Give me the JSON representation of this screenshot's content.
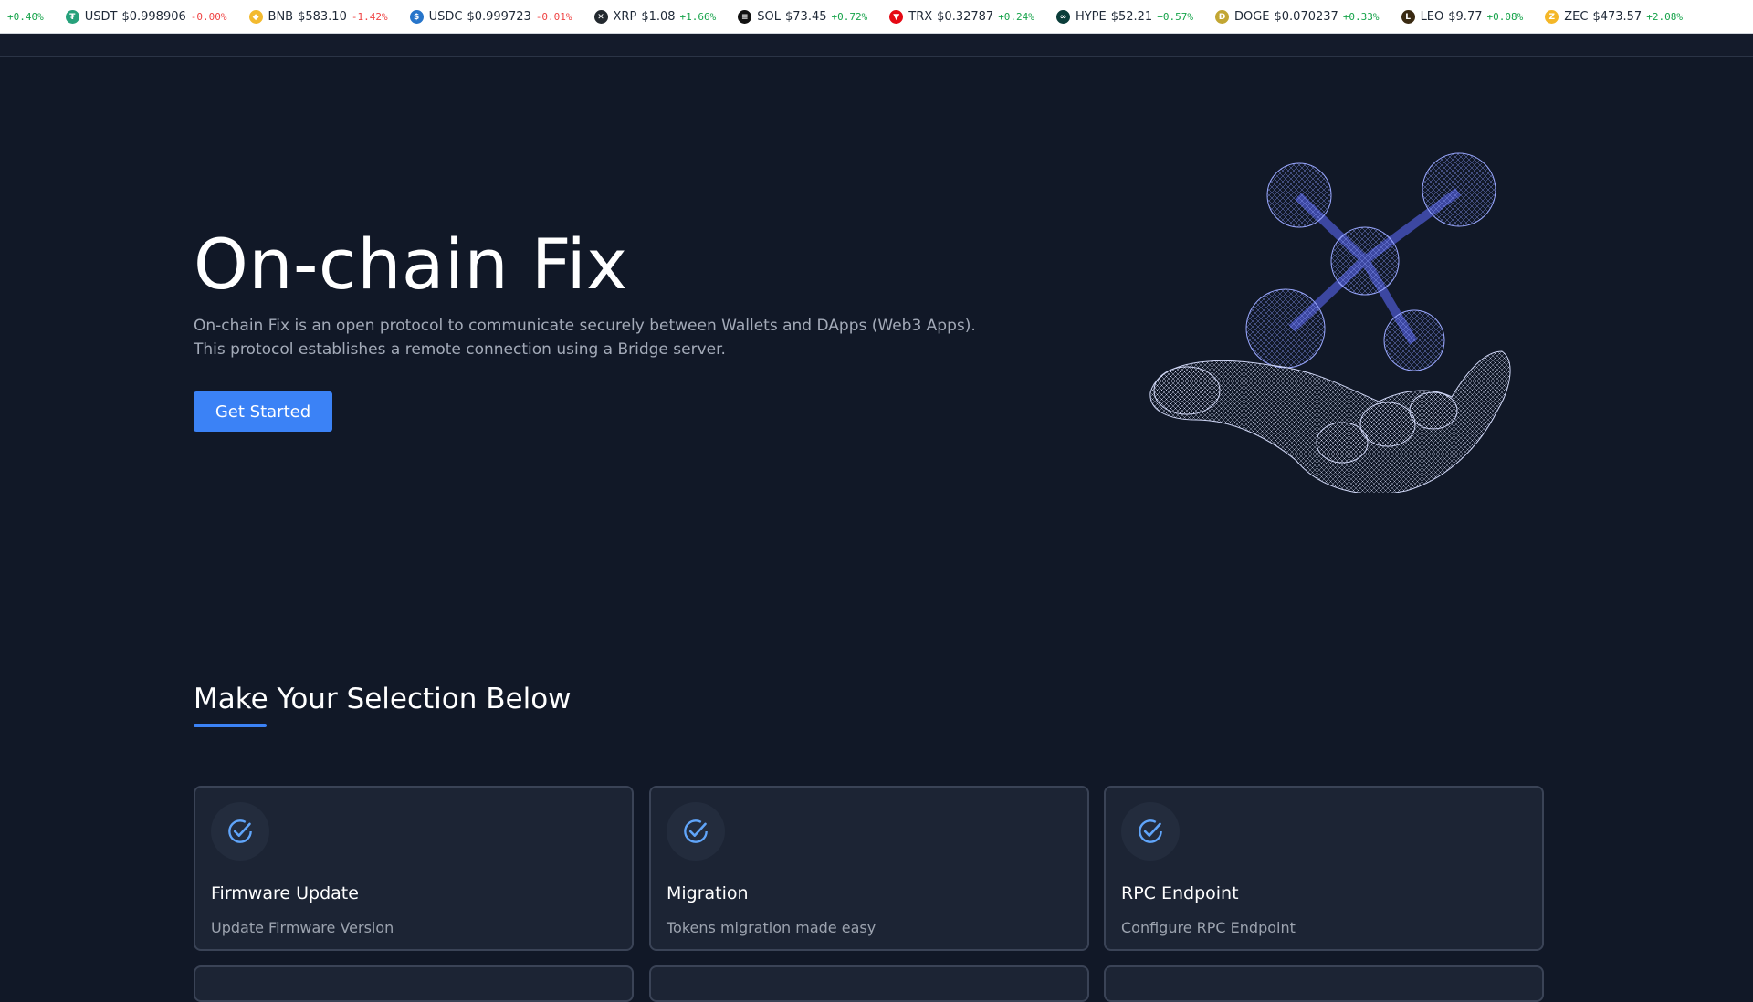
{
  "ticker": [
    {
      "symbol": "",
      "price": "",
      "change": "+0.40%",
      "dir": "up",
      "icon": "partial-coin-icon",
      "color": "#ffffff",
      "glyph": ""
    },
    {
      "symbol": "USDT",
      "price": "$0.998906",
      "change": "-0.00%",
      "dir": "down",
      "icon": "tether-icon",
      "color": "#26a17b",
      "glyph": "₮"
    },
    {
      "symbol": "BNB",
      "price": "$583.10",
      "change": "-1.42%",
      "dir": "down",
      "icon": "bnb-icon",
      "color": "#f3ba2f",
      "glyph": "◆"
    },
    {
      "symbol": "USDC",
      "price": "$0.999723",
      "change": "-0.01%",
      "dir": "down",
      "icon": "usdc-icon",
      "color": "#2775ca",
      "glyph": "$"
    },
    {
      "symbol": "XRP",
      "price": "$1.08",
      "change": "+1.66%",
      "dir": "up",
      "icon": "xrp-icon",
      "color": "#23292f",
      "glyph": "✕"
    },
    {
      "symbol": "SOL",
      "price": "$73.45",
      "change": "+0.72%",
      "dir": "up",
      "icon": "solana-icon",
      "color": "#111111",
      "glyph": "≡"
    },
    {
      "symbol": "TRX",
      "price": "$0.32787",
      "change": "+0.24%",
      "dir": "up",
      "icon": "tron-icon",
      "color": "#e50914",
      "glyph": "▼"
    },
    {
      "symbol": "HYPE",
      "price": "$52.21",
      "change": "+0.57%",
      "dir": "up",
      "icon": "hyperliquid-icon",
      "color": "#0b3d3a",
      "glyph": "∞"
    },
    {
      "symbol": "DOGE",
      "price": "$0.070237",
      "change": "+0.33%",
      "dir": "up",
      "icon": "dogecoin-icon",
      "color": "#c2a633",
      "glyph": "Ð"
    },
    {
      "symbol": "LEO",
      "price": "$9.77",
      "change": "+0.08%",
      "dir": "up",
      "icon": "leo-icon",
      "color": "#3a2a12",
      "glyph": "L"
    },
    {
      "symbol": "ZEC",
      "price": "$473.57",
      "change": "+2.08%",
      "dir": "up",
      "icon": "zcash-icon",
      "color": "#f4b728",
      "glyph": "Z"
    }
  ],
  "hero": {
    "title": "On-chain Fix",
    "description": "On-chain Fix is an open protocol to communicate securely between Wallets and DApps (Web3 Apps). This protocol establishes a remote connection using a Bridge server.",
    "cta_label": "Get Started"
  },
  "selection": {
    "title": "Make Your Selection Below",
    "cards": [
      {
        "title": "Firmware Update",
        "subtitle": "Update Firmware Version"
      },
      {
        "title": "Migration",
        "subtitle": "Tokens migration made easy"
      },
      {
        "title": "RPC Endpoint",
        "subtitle": "Configure RPC Endpoint"
      }
    ]
  },
  "colors": {
    "background": "#111827",
    "card": "#1c2434",
    "accent": "#3b82f6",
    "positive": "#16a34a",
    "negative": "#ef4444"
  }
}
